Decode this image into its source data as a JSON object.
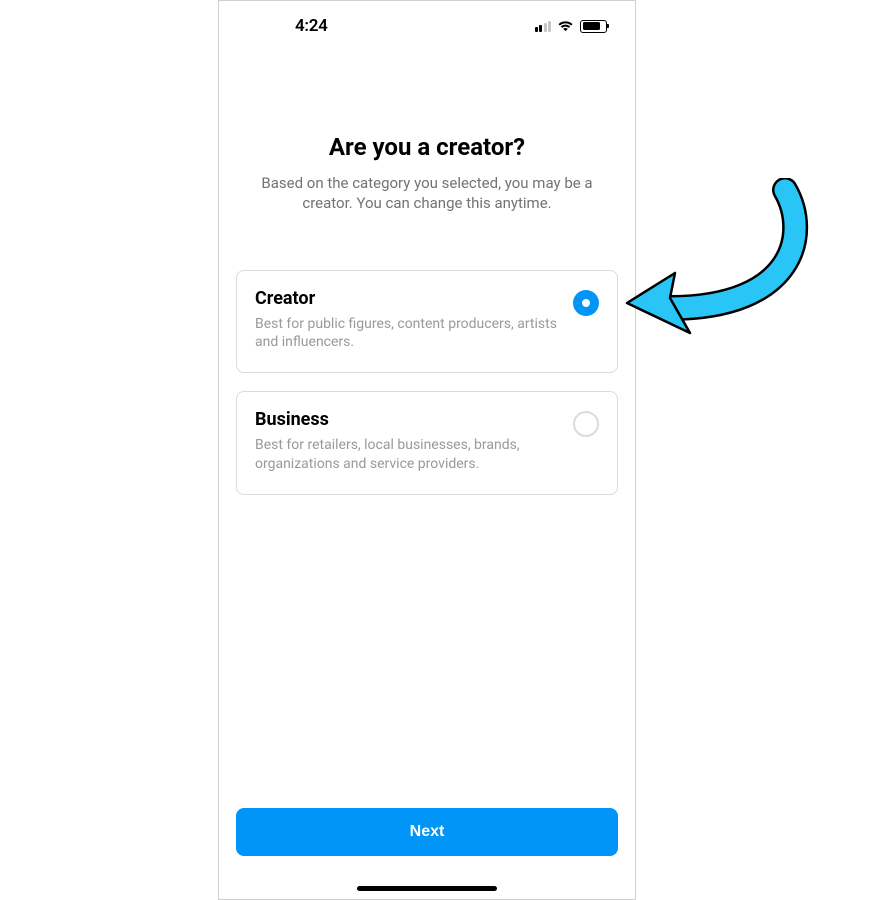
{
  "statusBar": {
    "time": "4:24"
  },
  "header": {
    "title": "Are you a creator?",
    "subtitle": "Based on the category you selected, you may be a creator. You can change this anytime."
  },
  "options": [
    {
      "title": "Creator",
      "description": "Best for public figures, content producers, artists and influencers.",
      "selected": true
    },
    {
      "title": "Business",
      "description": "Best for retailers, local businesses, brands, organizations and service providers.",
      "selected": false
    }
  ],
  "footer": {
    "nextLabel": "Next"
  },
  "colors": {
    "accent": "#0095f6",
    "annotationArrow": "#29c5f6"
  }
}
